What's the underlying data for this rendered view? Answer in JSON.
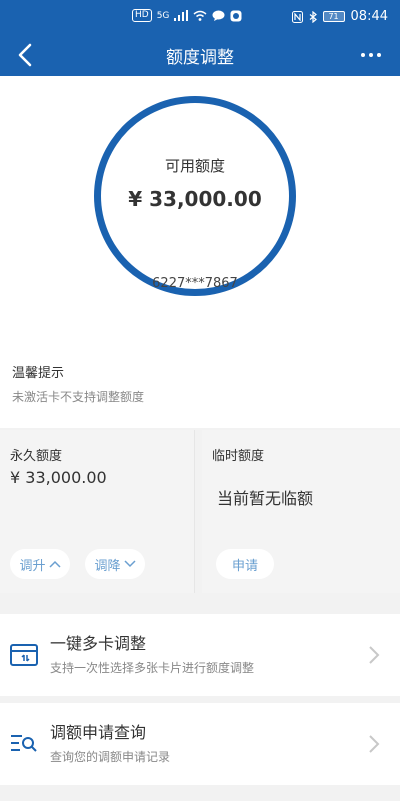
{
  "status_bar": {
    "left_icons": [
      "HD",
      "5G",
      "signal-icon",
      "wifi-icon",
      "chat-icon",
      "app-icon"
    ],
    "right_icons": [
      "nfc-icon",
      "bluetooth-icon",
      "battery-icon"
    ],
    "battery": "71",
    "time": "08:44"
  },
  "header": {
    "title": "额度调整"
  },
  "summary": {
    "label": "可用额度",
    "amount": "¥ 33,000.00",
    "card_number": "6227***7867"
  },
  "tips": {
    "title": "温馨提示",
    "text": "未激活卡不支持调整额度"
  },
  "permanent": {
    "title": "永久额度",
    "value": "¥ 33,000.00",
    "raise_label": "调升",
    "lower_label": "调降"
  },
  "temporary": {
    "title": "临时额度",
    "value": "当前暂无临额",
    "apply_label": "申请"
  },
  "menu": [
    {
      "title": "一键多卡调整",
      "subtitle": "支持一次性选择多张卡片进行额度调整",
      "icon": "card-transfer-icon"
    },
    {
      "title": "调额申请查询",
      "subtitle": "查询您的调额申请记录",
      "icon": "list-search-icon"
    }
  ],
  "colors": {
    "primary": "#1a62b0",
    "pill_text": "#6a9fd0"
  }
}
